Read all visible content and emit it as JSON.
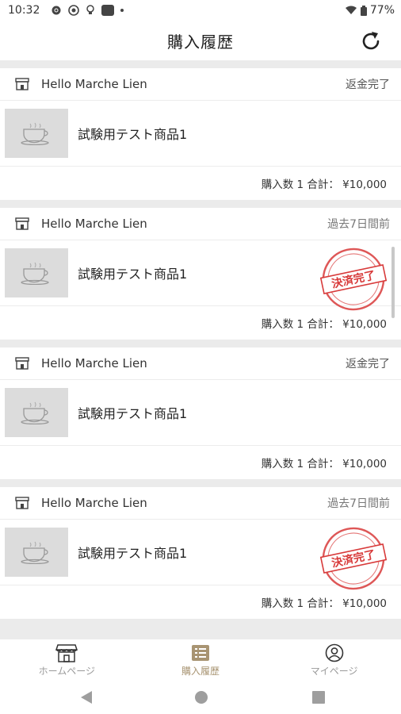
{
  "status_bar": {
    "time": "10:32",
    "battery": "77%"
  },
  "header": {
    "title": "購入履歴"
  },
  "orders": [
    {
      "shop": "Hello Marche Lien",
      "status": "返金完了",
      "product": "試験用テスト商品1",
      "summary": "購入数 1  合計：  ¥10,000",
      "stamp": ""
    },
    {
      "shop": "Hello Marche Lien",
      "status": "過去7日間前",
      "product": "試験用テスト商品1",
      "summary": "購入数 1  合計：  ¥10,000",
      "stamp": "決済完了"
    },
    {
      "shop": "Hello Marche Lien",
      "status": "返金完了",
      "product": "試験用テスト商品1",
      "summary": "購入数 1  合計：  ¥10,000",
      "stamp": ""
    },
    {
      "shop": "Hello Marche Lien",
      "status": "過去7日間前",
      "product": "試験用テスト商品1",
      "summary": "購入数 1  合計：  ¥10,000",
      "stamp": "決済完了"
    }
  ],
  "bottom_nav": {
    "home": "ホームページ",
    "history": "購入履歴",
    "mypage": "マイページ"
  },
  "colors": {
    "accent": "#a89472",
    "stamp_red": "#d83a3a",
    "inactive": "#9a9a9a"
  },
  "icons": [
    "settings-icon",
    "media-icon",
    "lightbulb-icon",
    "refresh-icon",
    "shop-icon",
    "coffee-cup-icon",
    "home-store-icon",
    "list-icon",
    "person-icon"
  ]
}
